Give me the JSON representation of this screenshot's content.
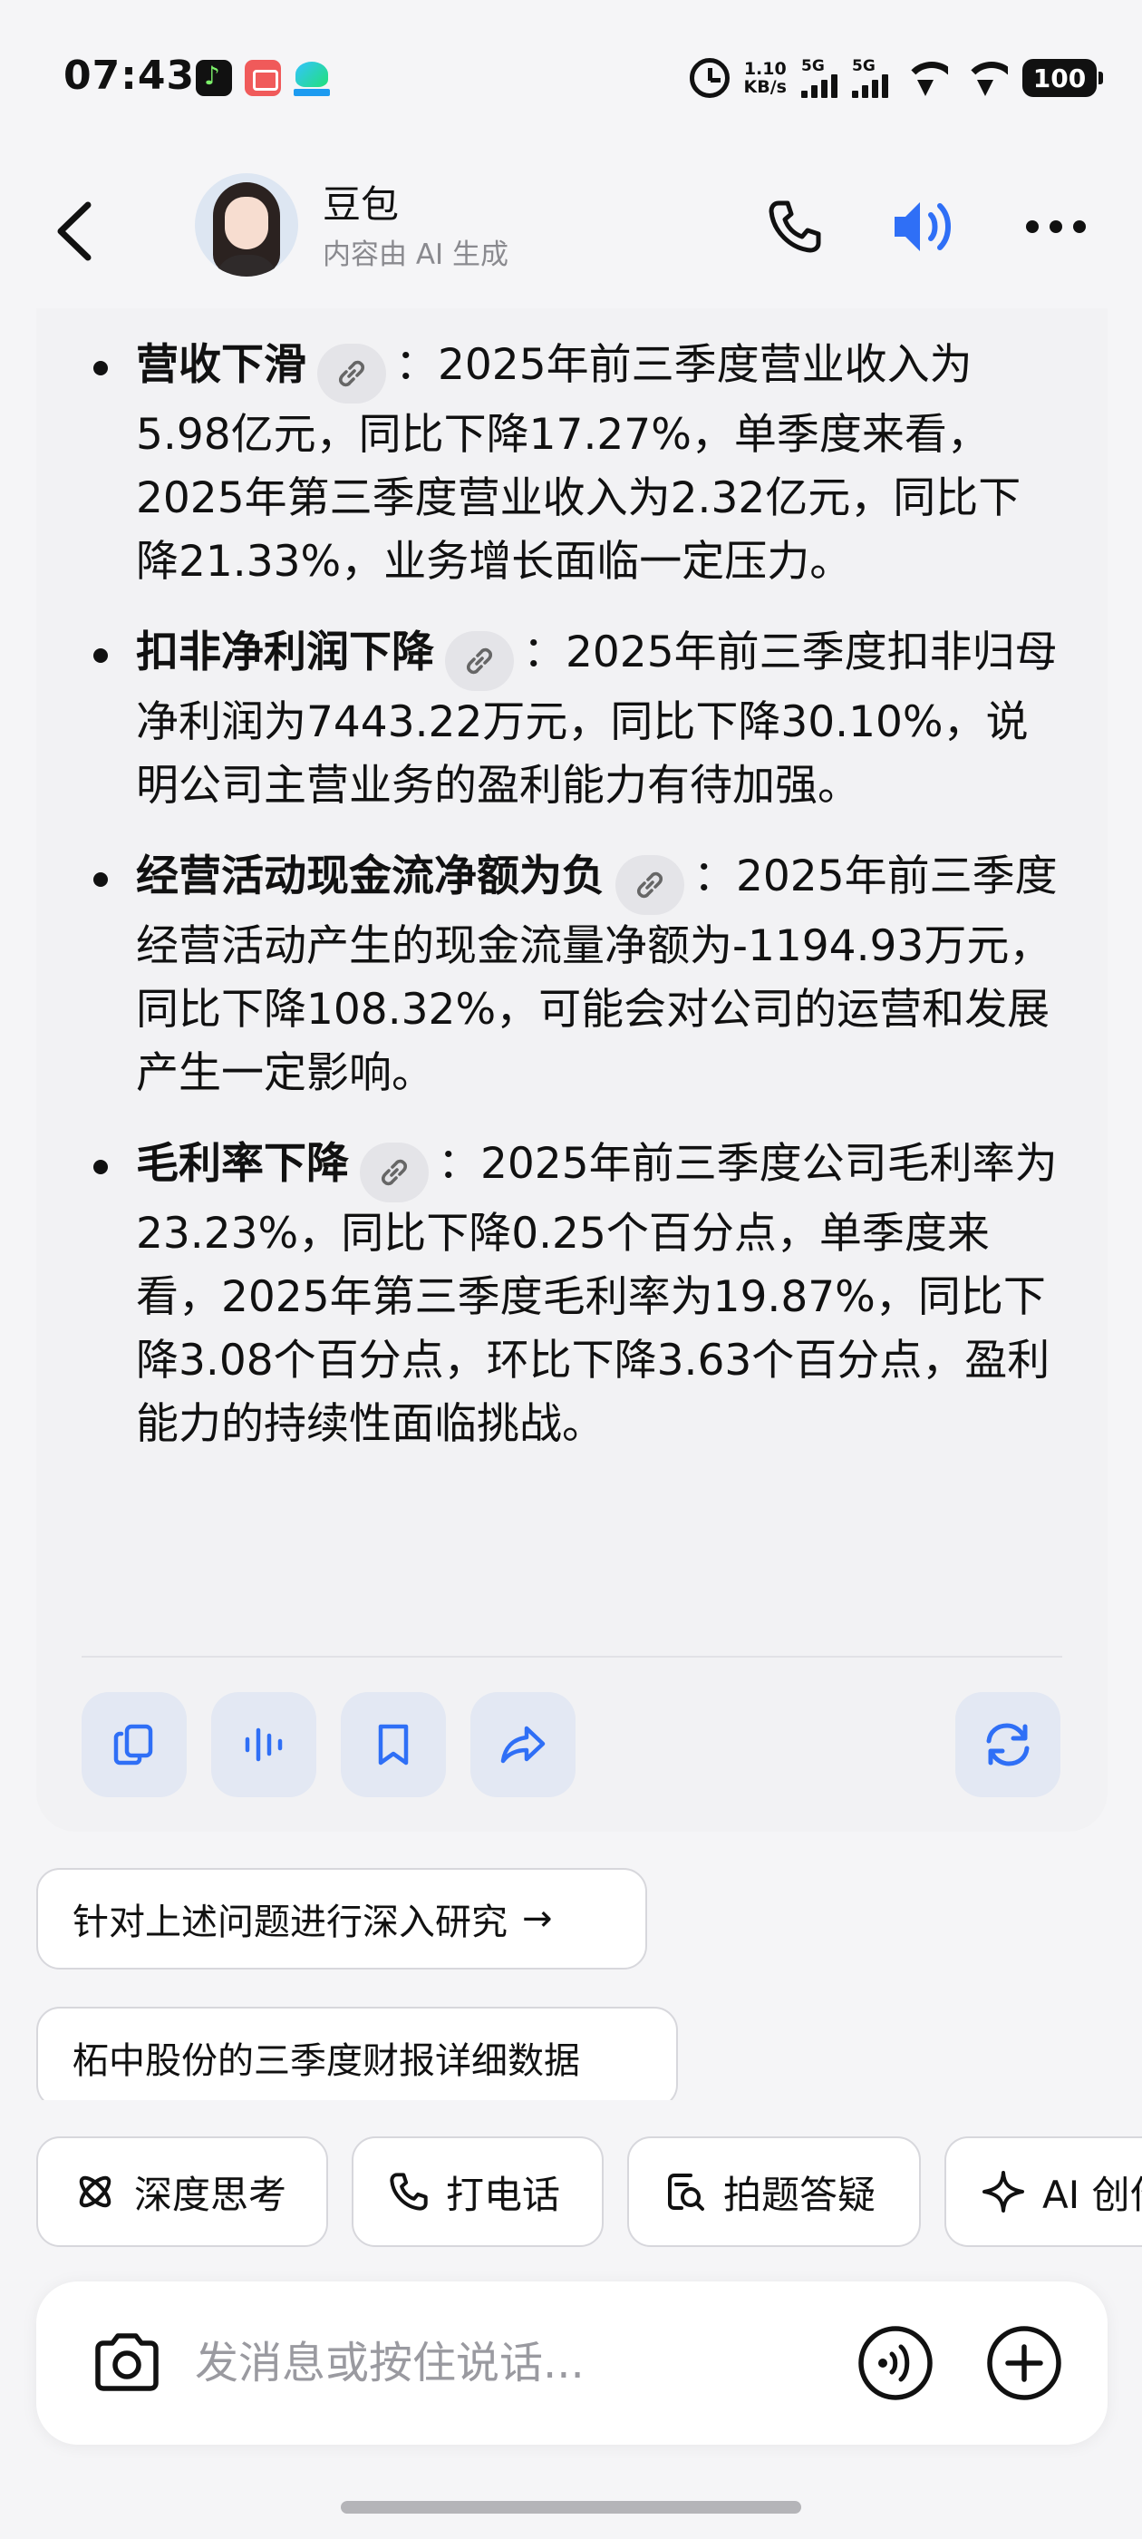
{
  "status_bar": {
    "time": "07:43",
    "net_speed_value": "1.10",
    "net_speed_unit": "KB/s",
    "signal_1_label": "5G",
    "signal_2_label": "5G",
    "battery": "100",
    "notification_icons": [
      "music-app-icon",
      "calendar-app-icon",
      "bird-app-icon"
    ]
  },
  "header": {
    "title": "豆包",
    "subtitle": "内容由 AI 生成",
    "accent_color": "#2f6ff6"
  },
  "message": {
    "points": [
      {
        "title": "营收下滑",
        "separator": "：",
        "text": "2025年前三季度营业收入为5.98亿元，同比下降17.27%，单季度来看，2025年第三季度营业收入为2.32亿元，同比下降21.33%，业务增长面临一定压力。"
      },
      {
        "title": "扣非净利润下降",
        "separator": "：",
        "text": "2025年前三季度扣非归母净利润为7443.22万元，同比下降30.10%，说明公司主营业务的盈利能力有待加强。"
      },
      {
        "title": "经营活动现金流净额为负",
        "separator": "：",
        "text": "2025年前三季度经营活动产生的现金流量净额为-1194.93万元，同比下降108.32%，可能会对公司的运营和发展产生一定影响。"
      },
      {
        "title": "毛利率下降",
        "separator": "：",
        "text": "2025年前三季度公司毛利率为23.23%，同比下降0.25个百分点，单季度来看，2025年第三季度毛利率为19.87%，同比下降3.08个百分点，环比下降3.63个百分点，盈利能力的持续性面临挑战。"
      }
    ],
    "actions": [
      "copy-icon",
      "read-aloud-icon",
      "bookmark-icon",
      "share-icon",
      "regenerate-icon"
    ]
  },
  "suggestions": {
    "deep_research": "针对上述问题进行深入研究",
    "deep_research_arrow": "→",
    "followup": "柘中股份的三季度财报详细数据"
  },
  "tools": {
    "deep_think": "深度思考",
    "call": "打电话",
    "photo_qa": "拍题答疑",
    "ai_create": "AI 创作"
  },
  "input": {
    "placeholder": "发消息或按住说话..."
  }
}
